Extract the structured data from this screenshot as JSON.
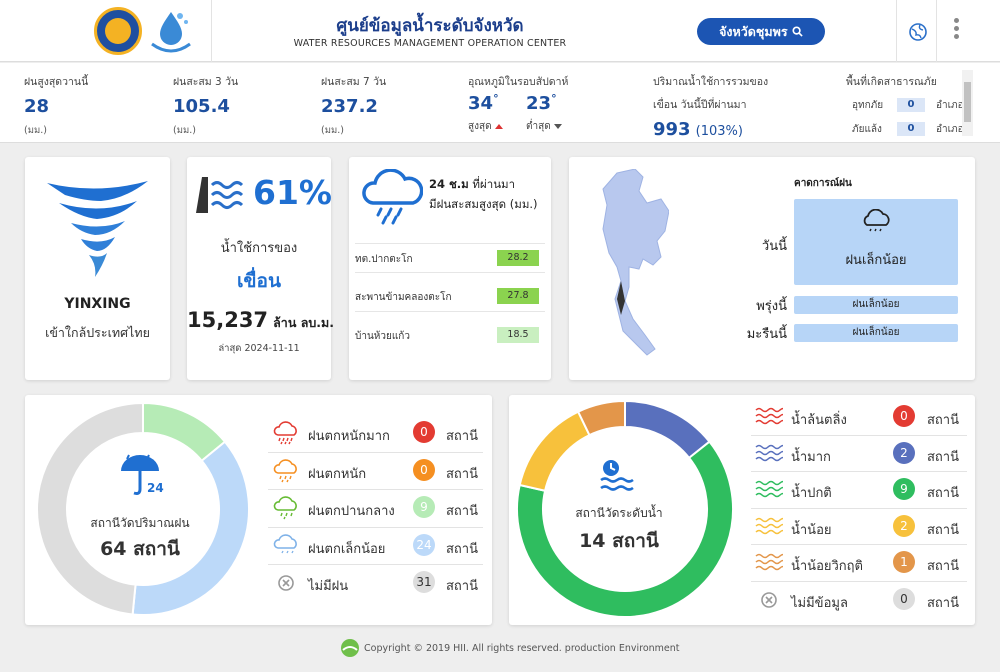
{
  "header": {
    "title": "ศูนย์ข้อมูลน้ำระดับจังหวัด",
    "subtitle": "WATER RESOURCES MANAGEMENT OPERATION CENTER",
    "province_button": "จังหวัดชุมพร",
    "icons": [
      "logo-emblem",
      "logo-water",
      "search-icon",
      "globe-icon",
      "kebab-menu-icon"
    ]
  },
  "stats": {
    "rain_today": {
      "label": "ฝนสูงสุดวานนี้",
      "value": "28",
      "unit": "(มม.)"
    },
    "rain_3d": {
      "label": "ฝนสะสม 3 วัน",
      "value": "105.4",
      "unit": "(มม.)"
    },
    "rain_7d": {
      "label": "ฝนสะสม 7 วัน",
      "value": "237.2",
      "unit": "(มม.)"
    },
    "temp": {
      "label": "อุณหภูมิในรอบสัปดาห์",
      "max": "34",
      "min": "23",
      "deg": "°",
      "max_label": "สูงสุด",
      "min_label": "ต่ำสุด"
    },
    "water_use": {
      "label1": "ปริมาณน้ำใช้การรวมของ",
      "label2": "เขื่อน วันนี้ปีที่ผ่านมา",
      "value": "993",
      "pct": "(103%)"
    },
    "disaster": {
      "label": "พื้นที่เกิดสาธารณภัย",
      "flood_label": "อุทกภัย",
      "flood_count": "0",
      "drought_label": "ภัยแล้ง",
      "drought_count": "0",
      "unit": "อำเภอ"
    }
  },
  "storm": {
    "name": "YINXING",
    "desc": "เข้าใกล้ประเทศไทย"
  },
  "dam": {
    "percent": "61%",
    "line1": "น้ำใช้การของ",
    "line2": "เขื่อน",
    "volume": "15,237",
    "volume_unit": "ล้าน ลบ.ม.",
    "updated": "ล่าสุด 2024-11-11"
  },
  "rain24": {
    "title1": "24 ช.ม",
    "title1b": " ที่ผ่านมา",
    "title2": "มีฝนสะสมสูงสุด (มม.)",
    "rows": [
      {
        "name": "ทต.ปากตะโก",
        "value": "28.2",
        "color": "#8bd34f"
      },
      {
        "name": "สะพานข้ามคลองตะโก",
        "value": "27.8",
        "color": "#8bd34f"
      },
      {
        "name": "บ้านห้วยแก้ว",
        "value": "18.5",
        "color": "#c9efc0"
      }
    ]
  },
  "forecast": {
    "title": "คาดการณ์ฝน",
    "today_label": "วันนี้",
    "today_value": "ฝนเล็กน้อย",
    "tomorrow_label": "พรุ่งนี้",
    "tomorrow_value": "ฝนเล็กน้อย",
    "dayafter_label": "มะรืนนี้",
    "dayafter_value": "ฝนเล็กน้อย",
    "box_color": "#b7d5f7"
  },
  "rain_stations": {
    "center_label": "สถานีวัดปริมาณฝน",
    "center_count": "64 สถานี",
    "icon_number": "24",
    "legend": [
      {
        "label": "ฝนตกหนักมาก",
        "count": "0",
        "unit": "สถานี",
        "color": "#e33b32",
        "icon": "heavy-rain-icon",
        "icon_color": "#e33b32"
      },
      {
        "label": "ฝนตกหนัก",
        "count": "0",
        "unit": "สถานี",
        "color": "#f58f21",
        "icon": "rain-icon",
        "icon_color": "#f58f21"
      },
      {
        "label": "ฝนตกปานกลาง",
        "count": "9",
        "unit": "สถานี",
        "color": "#b6ebb6",
        "icon": "moderate-rain-icon",
        "icon_color": "#66bb33"
      },
      {
        "label": "ฝนตกเล็กน้อย",
        "count": "24",
        "unit": "สถานี",
        "color": "#bcd9f9",
        "icon": "light-rain-icon",
        "icon_color": "#7fb2e8"
      },
      {
        "label": "ไม่มีฝน",
        "count": "31",
        "unit": "สถานี",
        "color": "#dddddd",
        "icon": "no-rain-icon",
        "icon_color": "#999999"
      }
    ]
  },
  "level_stations": {
    "center_label": "สถานีวัดระดับน้ำ",
    "center_count": "14 สถานี",
    "legend": [
      {
        "label": "น้ำล้นตลิ่ง",
        "count": "0",
        "unit": "สถานี",
        "color": "#e33b32",
        "icon": "overflow-icon"
      },
      {
        "label": "น้ำมาก",
        "count": "2",
        "unit": "สถานี",
        "color": "#5970bd",
        "icon": "high-water-icon"
      },
      {
        "label": "น้ำปกติ",
        "count": "9",
        "unit": "สถานี",
        "color": "#2fbd5f",
        "icon": "normal-water-icon"
      },
      {
        "label": "น้ำน้อย",
        "count": "2",
        "unit": "สถานี",
        "color": "#f7c13c",
        "icon": "low-water-icon"
      },
      {
        "label": "น้ำน้อยวิกฤติ",
        "count": "1",
        "unit": "สถานี",
        "color": "#e3964a",
        "icon": "critical-low-icon"
      },
      {
        "label": "ไม่มีข้อมูล",
        "count": "0",
        "unit": "สถานี",
        "color": "#dddddd",
        "icon": "no-data-icon"
      }
    ]
  },
  "footer": {
    "text": "Copyright © 2019 HII. All rights reserved. production Environment"
  }
}
